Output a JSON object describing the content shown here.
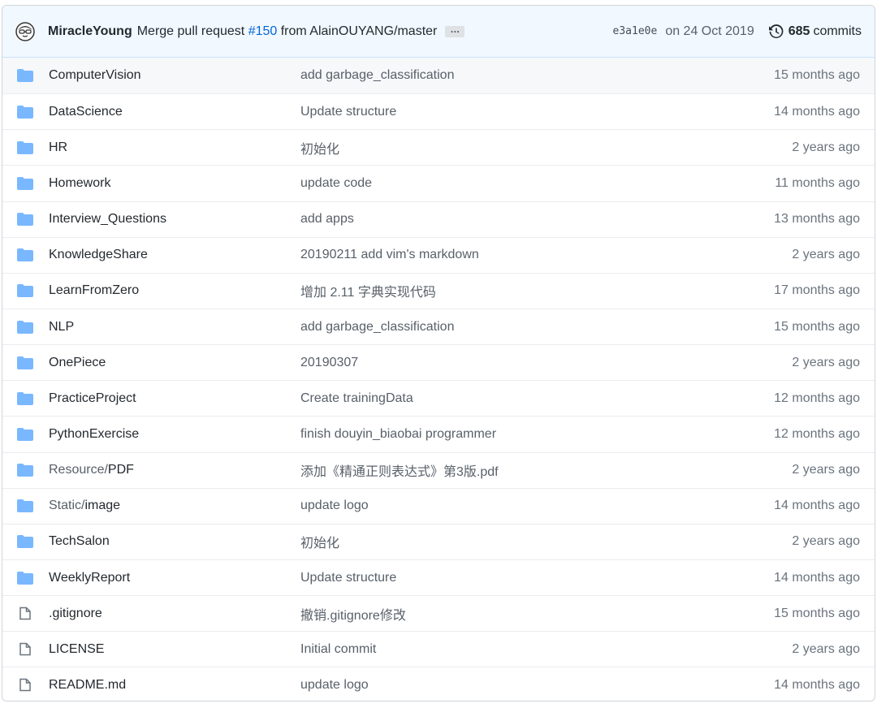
{
  "commit": {
    "author": "MiracleYoung",
    "message_prefix": "Merge pull request ",
    "pr_link": "#150",
    "message_suffix": " from AlainOUYANG/master",
    "ellipsis": "…",
    "sha": "e3a1e0e",
    "date": "on 24 Oct 2019",
    "commit_count": "685",
    "commits_label": "commits"
  },
  "colors": {
    "folder": "#79b8ff",
    "link": "#0366d6"
  },
  "files": [
    {
      "type": "folder",
      "dir": "",
      "name": "ComputerVision",
      "message": "add garbage_classification",
      "age": "15 months ago"
    },
    {
      "type": "folder",
      "dir": "",
      "name": "DataScience",
      "message": "Update structure",
      "age": "14 months ago"
    },
    {
      "type": "folder",
      "dir": "",
      "name": "HR",
      "message": "初始化",
      "age": "2 years ago"
    },
    {
      "type": "folder",
      "dir": "",
      "name": "Homework",
      "message": "update code",
      "age": "11 months ago"
    },
    {
      "type": "folder",
      "dir": "",
      "name": "Interview_Questions",
      "message": "add apps",
      "age": "13 months ago"
    },
    {
      "type": "folder",
      "dir": "",
      "name": "KnowledgeShare",
      "message": "20190211 add vim's markdown",
      "age": "2 years ago"
    },
    {
      "type": "folder",
      "dir": "",
      "name": "LearnFromZero",
      "message": "增加 2.11 字典实现代码",
      "age": "17 months ago"
    },
    {
      "type": "folder",
      "dir": "",
      "name": "NLP",
      "message": "add garbage_classification",
      "age": "15 months ago"
    },
    {
      "type": "folder",
      "dir": "",
      "name": "OnePiece",
      "message": "20190307",
      "age": "2 years ago"
    },
    {
      "type": "folder",
      "dir": "",
      "name": "PracticeProject",
      "message": "Create trainingData",
      "age": "12 months ago"
    },
    {
      "type": "folder",
      "dir": "",
      "name": "PythonExercise",
      "message": "finish douyin_biaobai programmer",
      "age": "12 months ago"
    },
    {
      "type": "folder",
      "dir": "Resource/",
      "name": "PDF",
      "message": "添加《精通正则表达式》第3版.pdf",
      "age": "2 years ago"
    },
    {
      "type": "folder",
      "dir": "Static/",
      "name": "image",
      "message": "update logo",
      "age": "14 months ago"
    },
    {
      "type": "folder",
      "dir": "",
      "name": "TechSalon",
      "message": "初始化",
      "age": "2 years ago"
    },
    {
      "type": "folder",
      "dir": "",
      "name": "WeeklyReport",
      "message": "Update structure",
      "age": "14 months ago"
    },
    {
      "type": "file",
      "dir": "",
      "name": ".gitignore",
      "message": "撤销.gitignore修改",
      "age": "15 months ago"
    },
    {
      "type": "file",
      "dir": "",
      "name": "LICENSE",
      "message": "Initial commit",
      "age": "2 years ago"
    },
    {
      "type": "file",
      "dir": "",
      "name": "README.md",
      "message": "update logo",
      "age": "14 months ago"
    }
  ]
}
